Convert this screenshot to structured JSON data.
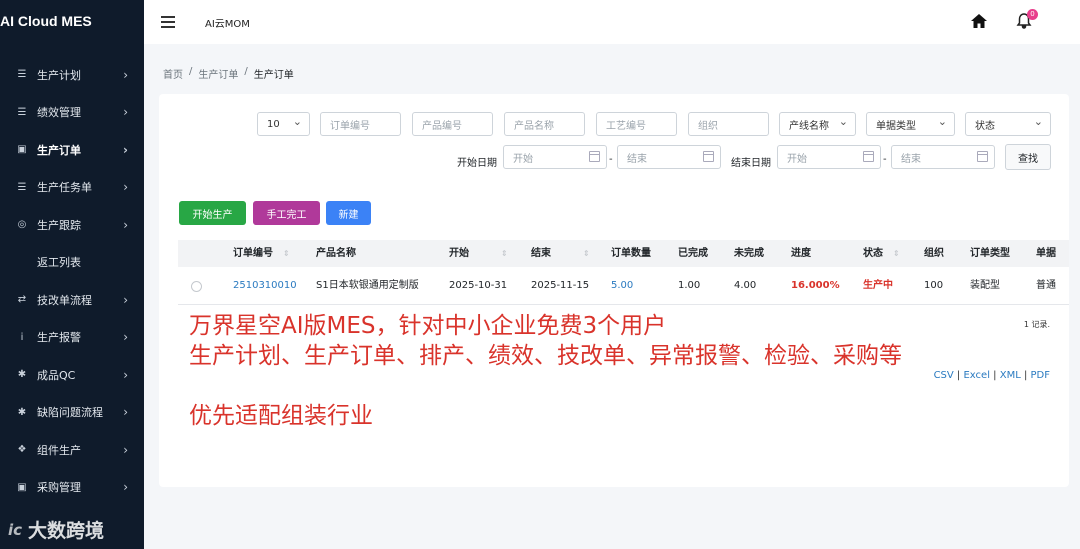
{
  "brand": "AI Cloud MES",
  "app_title": "AI云MOM",
  "notification_count": "0",
  "sidebar": {
    "items": [
      {
        "label": "生产计划",
        "icon": "list-icon"
      },
      {
        "label": "绩效管理",
        "icon": "list-icon"
      },
      {
        "label": "生产订单",
        "icon": "image-icon",
        "active": true
      },
      {
        "label": "生产任务单",
        "icon": "list-icon"
      },
      {
        "label": "生产跟踪",
        "icon": "target-icon"
      },
      {
        "label": "返工列表",
        "icon": ""
      },
      {
        "label": "技改单流程",
        "icon": "exchange-icon"
      },
      {
        "label": "生产报警",
        "icon": "info-icon"
      },
      {
        "label": "成品QC",
        "icon": "bug-icon"
      },
      {
        "label": "缺陷问题流程",
        "icon": "bug-icon"
      },
      {
        "label": "组件生产",
        "icon": "puzzle-icon"
      },
      {
        "label": "采购管理",
        "icon": "box-icon"
      }
    ]
  },
  "watermark": "大数跨境",
  "breadcrumb": [
    "首页",
    "生产订单",
    "生产订单"
  ],
  "filters": {
    "page_size": "10",
    "order_no_placeholder": "订单编号",
    "product_no_placeholder": "产品编号",
    "product_name_placeholder": "产品名称",
    "process_no_placeholder": "工艺编号",
    "org_placeholder": "组织",
    "line_name": "产线名称",
    "doc_type": "单据类型",
    "status": "状态",
    "start_date_label": "开始日期",
    "end_date_label": "结束日期",
    "start_placeholder": "开始",
    "end_placeholder": "结束",
    "dash": "-",
    "search_label": "查找"
  },
  "actions": {
    "start_production": "开始生产",
    "manual_complete": "手工完工",
    "new": "新建"
  },
  "table": {
    "headers": [
      "订单编号",
      "产品名称",
      "开始",
      "结束",
      "订单数量",
      "已完成",
      "未完成",
      "进度",
      "状态",
      "组织",
      "订单类型",
      "单据"
    ],
    "rows": [
      {
        "order_no": "2510310010",
        "product_name": "S1日本软银通用定制版",
        "start": "2025-10-31",
        "end": "2025-11-15",
        "qty": "5.00",
        "done": "1.00",
        "undone": "4.00",
        "progress": "16.000%",
        "status": "生产中",
        "org": "100",
        "order_type": "装配型",
        "doc": "普通"
      }
    ]
  },
  "record_count": "1 记录.",
  "exports": [
    "CSV",
    "Excel",
    "XML",
    "PDF"
  ],
  "overlay_text": {
    "line1": "万界星空AI版MES，针对中小企业免费3个用户",
    "line2": "生产计划、生产订单、排产、绩效、技改单、异常报警、检验、采购等",
    "line3": "优先适配组装行业"
  },
  "colors": {
    "sidebar_bg": "#0f1b2b",
    "accent_blue": "#3b82f6",
    "accent_green": "#28a745",
    "accent_purple": "#b0399a",
    "overlay_red": "#d9332b",
    "link_blue": "#2a7ac0"
  }
}
